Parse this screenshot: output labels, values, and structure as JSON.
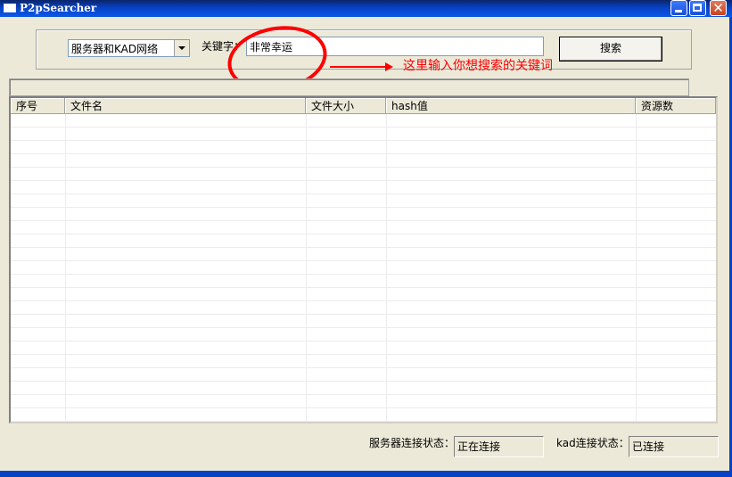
{
  "window": {
    "title": "P2pSearcher"
  },
  "search": {
    "network_selected": "服务器和KAD网络",
    "keyword_label": "关键字：",
    "keyword_value": "非常幸运",
    "search_button": "搜索"
  },
  "annotation": {
    "text": "这里输入你想搜索的关键词",
    "color": "#ff0000"
  },
  "results": {
    "columns": [
      "序号",
      "文件名",
      "文件大小",
      "hash值",
      "资源数"
    ],
    "rows": []
  },
  "status": {
    "server_label": "服务器连接状态：",
    "server_value": "正在连接",
    "kad_label": "kad连接状态：",
    "kad_value": "已连接"
  },
  "colors": {
    "titlebar": "#0842c4",
    "window_bg": "#ece9d8",
    "close_button": "#c64421"
  }
}
